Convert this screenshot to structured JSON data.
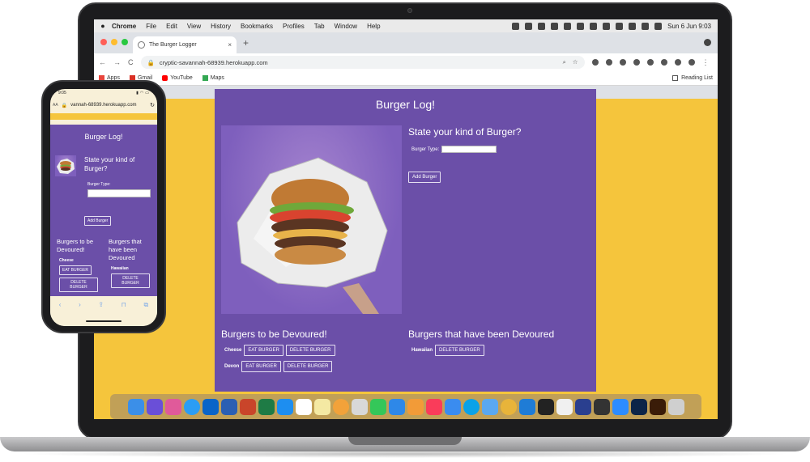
{
  "menubar": {
    "apple": "",
    "app": "Chrome",
    "items": [
      "File",
      "Edit",
      "View",
      "History",
      "Bookmarks",
      "Profiles",
      "Tab",
      "Window",
      "Help"
    ],
    "clock": "Sun 6 Jun  9:03"
  },
  "browser": {
    "tab_title": "The Burger Logger",
    "tab_close": "×",
    "new_tab": "+",
    "url": "cryptic-savannah-68939.herokuapp.com",
    "nav": {
      "back": "←",
      "forward": "→",
      "reload": "C"
    },
    "bookmarks": [
      {
        "label": "Apps",
        "icon": "apps-grid-icon",
        "color": "#e8453c"
      },
      {
        "label": "Gmail",
        "icon": "gmail-icon",
        "color": "#d93025"
      },
      {
        "label": "YouTube",
        "icon": "youtube-icon",
        "color": "#ff0000"
      },
      {
        "label": "Maps",
        "icon": "maps-icon",
        "color": "#34a853"
      }
    ],
    "reading_list": "Reading List"
  },
  "app": {
    "title": "Burger Log!",
    "form_heading": "State your kind of Burger?",
    "type_label": "Burger Type:",
    "type_value": "",
    "add_button": "Add Burger",
    "to_devour_heading": "Burgers to be Devoured!",
    "devoured_heading": "Burgers that have been Devoured",
    "to_devour": [
      {
        "name": "Cheese",
        "eat": "EAT BURGER",
        "delete": "DELETE BURGER"
      },
      {
        "name": "Devon",
        "eat": "EAT BURGER",
        "delete": "DELETE BURGER"
      }
    ],
    "devoured": [
      {
        "name": "Hawaiian",
        "delete": "DELETE BURGER"
      }
    ]
  },
  "phone": {
    "time": "9:05",
    "aa": "AA",
    "url": "vannah-68939.herokuapp.com",
    "title": "Burger Log!",
    "form_heading": "State your kind of Burger?",
    "type_label": "Burger Type:",
    "add_button": "Add Burger",
    "col1_heading": "Burgers to be Devoured!",
    "col1_item": "Cheese",
    "col1_eat": "EAT BURGER",
    "col1_delete": "DELETE BURGER",
    "col2_heading": "Burgers that have been Devoured",
    "col2_item": "Hawaiian",
    "col2_delete": "DELETE BURGER"
  },
  "colors": {
    "page_background": "#f5c53c",
    "panel": "#6b4fa8",
    "device_frame": "#1c1c1e"
  },
  "dock_icons": [
    "finder-icon",
    "siri-icon",
    "launchpad-icon",
    "safari-icon",
    "outlook-icon",
    "word-icon",
    "powerpoint-icon",
    "excel-icon",
    "app-store-icon",
    "calendar-icon",
    "notes-icon",
    "photos-icon",
    "preview-icon",
    "numbers-icon",
    "keynote-icon",
    "feedback-icon",
    "music-icon",
    "mail-icon",
    "skype-icon",
    "icloud-icon",
    "chrome-icon",
    "vscode-icon",
    "terminal-icon",
    "textedit-icon",
    "xcode-icon",
    "sublime-icon",
    "zoom-icon",
    "photoshop-icon",
    "illustrator-icon",
    "trash-icon"
  ]
}
